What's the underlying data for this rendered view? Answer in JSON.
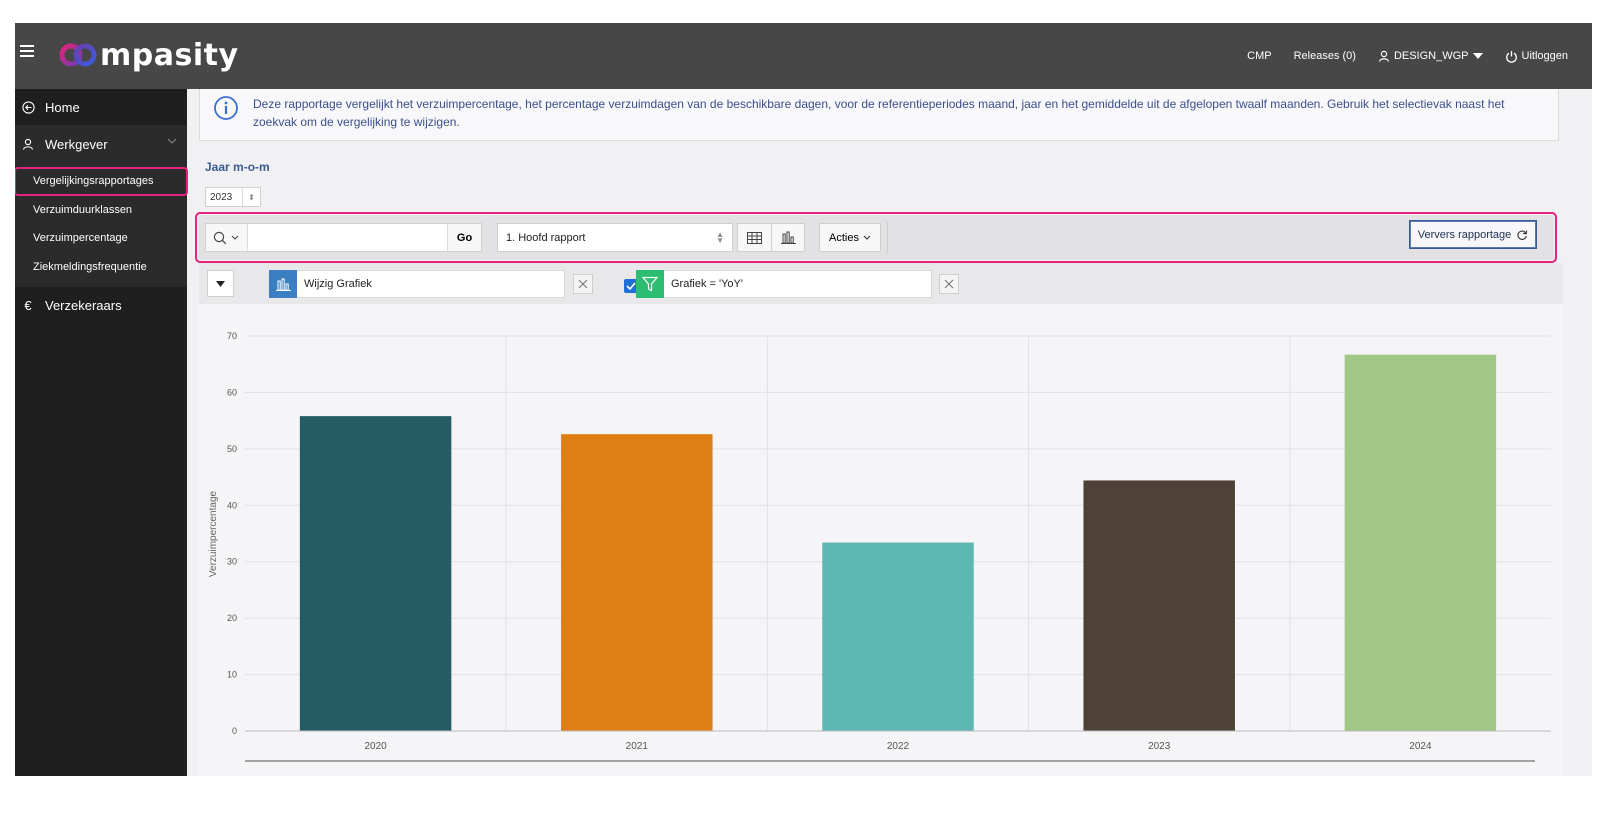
{
  "header": {
    "brand": "mpasity",
    "nav": {
      "cmp": "CMP",
      "releases": "Releases (0)",
      "user": "DESIGN_WGP",
      "logout": "Uitloggen"
    }
  },
  "sidebar": {
    "home": "Home",
    "werkgever": "Werkgever",
    "werkgever_items": [
      "Vergelijkingsrapportages",
      "Verzuimduurklassen",
      "Verzuimpercentage",
      "Ziekmeldingsfrequentie"
    ],
    "verzekeraars": "Verzekeraars"
  },
  "info": {
    "text": "Deze rapportage vergelijkt het verzuimpercentage, het percentage verzuimdagen van de beschikbare dagen, voor de referentieperiodes maand, jaar en het gemiddelde uit de afgelopen twaalf maanden. Gebruik het selectievak naast het zoekvak om de vergelijking te wijzigen."
  },
  "report": {
    "title": "Jaar m-o-m",
    "year": "2023"
  },
  "toolbar": {
    "search_value": "",
    "go": "Go",
    "report_select": "1. Hoofd rapport",
    "acties": "Acties",
    "refresh": "Ververs rapportage"
  },
  "filters": {
    "chart_chip": "Wijzig Grafiek",
    "filter_chip": "Grafiek = 'YoY'"
  },
  "colors": {
    "accent": "#e3237c",
    "bar_2020": "#245c64",
    "bar_2021": "#de7e13",
    "bar_2022": "#5db7b3",
    "bar_2023": "#4e4138",
    "bar_2024": "#a1c886"
  },
  "chart_data": {
    "type": "bar",
    "categories": [
      "2020",
      "2021",
      "2022",
      "2023",
      "2024"
    ],
    "values": [
      55.8,
      52.6,
      33.4,
      44.4,
      66.7
    ],
    "ylabel": "Verzuimpercentage",
    "xlabel": "",
    "ylim": [
      0,
      70
    ],
    "yticks": [
      "0",
      "10",
      "20",
      "30",
      "40",
      "50",
      "60",
      "70"
    ],
    "grid": true
  }
}
